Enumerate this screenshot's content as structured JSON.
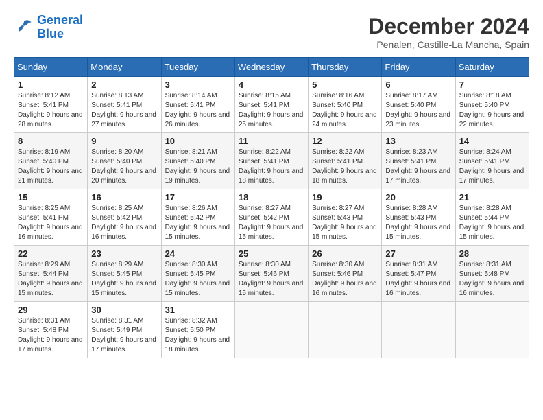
{
  "logo": {
    "line1": "General",
    "line2": "Blue"
  },
  "title": "December 2024",
  "subtitle": "Penalen, Castille-La Mancha, Spain",
  "weekdays": [
    "Sunday",
    "Monday",
    "Tuesday",
    "Wednesday",
    "Thursday",
    "Friday",
    "Saturday"
  ],
  "weeks": [
    [
      {
        "day": "1",
        "sunrise": "8:12 AM",
        "sunset": "5:41 PM",
        "daylight": "9 hours and 28 minutes."
      },
      {
        "day": "2",
        "sunrise": "8:13 AM",
        "sunset": "5:41 PM",
        "daylight": "9 hours and 27 minutes."
      },
      {
        "day": "3",
        "sunrise": "8:14 AM",
        "sunset": "5:41 PM",
        "daylight": "9 hours and 26 minutes."
      },
      {
        "day": "4",
        "sunrise": "8:15 AM",
        "sunset": "5:41 PM",
        "daylight": "9 hours and 25 minutes."
      },
      {
        "day": "5",
        "sunrise": "8:16 AM",
        "sunset": "5:40 PM",
        "daylight": "9 hours and 24 minutes."
      },
      {
        "day": "6",
        "sunrise": "8:17 AM",
        "sunset": "5:40 PM",
        "daylight": "9 hours and 23 minutes."
      },
      {
        "day": "7",
        "sunrise": "8:18 AM",
        "sunset": "5:40 PM",
        "daylight": "9 hours and 22 minutes."
      }
    ],
    [
      {
        "day": "8",
        "sunrise": "8:19 AM",
        "sunset": "5:40 PM",
        "daylight": "9 hours and 21 minutes."
      },
      {
        "day": "9",
        "sunrise": "8:20 AM",
        "sunset": "5:40 PM",
        "daylight": "9 hours and 20 minutes."
      },
      {
        "day": "10",
        "sunrise": "8:21 AM",
        "sunset": "5:40 PM",
        "daylight": "9 hours and 19 minutes."
      },
      {
        "day": "11",
        "sunrise": "8:22 AM",
        "sunset": "5:41 PM",
        "daylight": "9 hours and 18 minutes."
      },
      {
        "day": "12",
        "sunrise": "8:22 AM",
        "sunset": "5:41 PM",
        "daylight": "9 hours and 18 minutes."
      },
      {
        "day": "13",
        "sunrise": "8:23 AM",
        "sunset": "5:41 PM",
        "daylight": "9 hours and 17 minutes."
      },
      {
        "day": "14",
        "sunrise": "8:24 AM",
        "sunset": "5:41 PM",
        "daylight": "9 hours and 17 minutes."
      }
    ],
    [
      {
        "day": "15",
        "sunrise": "8:25 AM",
        "sunset": "5:41 PM",
        "daylight": "9 hours and 16 minutes."
      },
      {
        "day": "16",
        "sunrise": "8:25 AM",
        "sunset": "5:42 PM",
        "daylight": "9 hours and 16 minutes."
      },
      {
        "day": "17",
        "sunrise": "8:26 AM",
        "sunset": "5:42 PM",
        "daylight": "9 hours and 15 minutes."
      },
      {
        "day": "18",
        "sunrise": "8:27 AM",
        "sunset": "5:42 PM",
        "daylight": "9 hours and 15 minutes."
      },
      {
        "day": "19",
        "sunrise": "8:27 AM",
        "sunset": "5:43 PM",
        "daylight": "9 hours and 15 minutes."
      },
      {
        "day": "20",
        "sunrise": "8:28 AM",
        "sunset": "5:43 PM",
        "daylight": "9 hours and 15 minutes."
      },
      {
        "day": "21",
        "sunrise": "8:28 AM",
        "sunset": "5:44 PM",
        "daylight": "9 hours and 15 minutes."
      }
    ],
    [
      {
        "day": "22",
        "sunrise": "8:29 AM",
        "sunset": "5:44 PM",
        "daylight": "9 hours and 15 minutes."
      },
      {
        "day": "23",
        "sunrise": "8:29 AM",
        "sunset": "5:45 PM",
        "daylight": "9 hours and 15 minutes."
      },
      {
        "day": "24",
        "sunrise": "8:30 AM",
        "sunset": "5:45 PM",
        "daylight": "9 hours and 15 minutes."
      },
      {
        "day": "25",
        "sunrise": "8:30 AM",
        "sunset": "5:46 PM",
        "daylight": "9 hours and 15 minutes."
      },
      {
        "day": "26",
        "sunrise": "8:30 AM",
        "sunset": "5:46 PM",
        "daylight": "9 hours and 16 minutes."
      },
      {
        "day": "27",
        "sunrise": "8:31 AM",
        "sunset": "5:47 PM",
        "daylight": "9 hours and 16 minutes."
      },
      {
        "day": "28",
        "sunrise": "8:31 AM",
        "sunset": "5:48 PM",
        "daylight": "9 hours and 16 minutes."
      }
    ],
    [
      {
        "day": "29",
        "sunrise": "8:31 AM",
        "sunset": "5:48 PM",
        "daylight": "9 hours and 17 minutes."
      },
      {
        "day": "30",
        "sunrise": "8:31 AM",
        "sunset": "5:49 PM",
        "daylight": "9 hours and 17 minutes."
      },
      {
        "day": "31",
        "sunrise": "8:32 AM",
        "sunset": "5:50 PM",
        "daylight": "9 hours and 18 minutes."
      },
      null,
      null,
      null,
      null
    ]
  ]
}
